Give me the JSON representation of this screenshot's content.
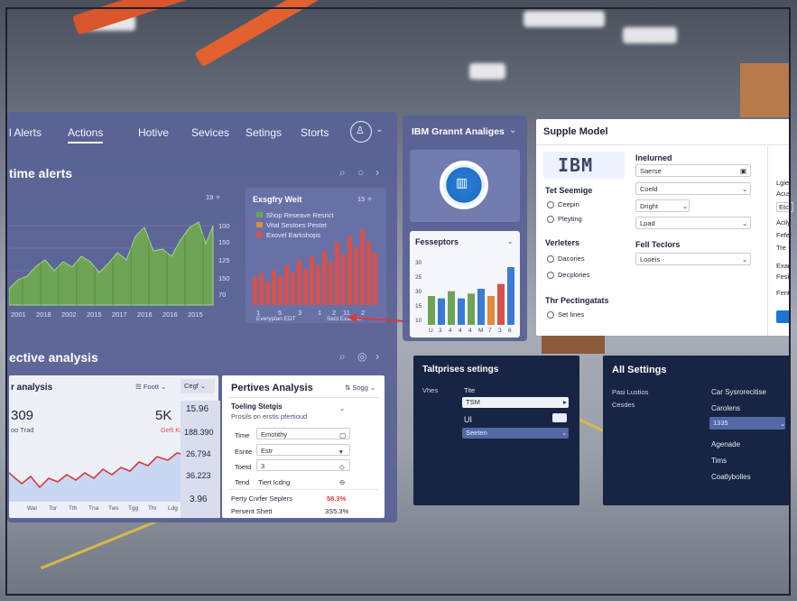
{
  "nav": {
    "items": [
      "l Alerts",
      "Actions",
      "Hotive",
      "Sevices",
      "Setings",
      "Storts"
    ]
  },
  "alerts": {
    "title": "time alerts",
    "chart1_badge": "19 ✧",
    "chart2_title": "Exsgfry Weit",
    "chart2_badge": "15 ✧",
    "chart2_legend": [
      "Shop Reseave Resrict",
      "Vital Sestoes Pestet",
      "Exovel Earkshops"
    ],
    "axis_ticks": [
      "100",
      "150",
      "125",
      "150",
      "70"
    ],
    "x_labels1": [
      "2001",
      "2018",
      "2002",
      "2015",
      "2017",
      "2016",
      "2016",
      "2015"
    ],
    "x_labels2": [
      "1",
      "5",
      "3",
      "1",
      "2",
      "11",
      "2"
    ],
    "chart2_foot_left": "Everyplan EDT",
    "chart2_foot_right": "Sect Exal Ser"
  },
  "predictive": {
    "title": "ective analysis",
    "sub_title": "r analysis",
    "filter_label": "Foott",
    "dropdown": "Cegf",
    "big_left": "309",
    "big_left_sub": "oo Trad",
    "big_right": "5K",
    "big_right_sub": "Geft Kigt",
    "x_labels": [
      "Wal",
      "Tor",
      "Tth",
      "Tna",
      "Tws",
      "Tgg",
      "Thr",
      "Ldg"
    ],
    "side_values": [
      "15.96",
      "188.390",
      "26.794",
      "36.223",
      "3.96"
    ]
  },
  "perives": {
    "title": "Pertives Analysis",
    "dropdown": "Sogg",
    "setting_title": "Toeling Stetgis",
    "setting_sub": "Prosils on erstis pfertioud",
    "rows": [
      {
        "label": "Time",
        "value": "Emotithy"
      },
      {
        "label": "Esnte",
        "value": "Estr"
      },
      {
        "label": "Toetd",
        "value": "3"
      },
      {
        "label": "Tend",
        "value": "Tiert Icdng"
      }
    ],
    "footer": [
      {
        "label": "Perty Cnrfer Seplers",
        "value": "58.3%"
      },
      {
        "label": "Persent Shett",
        "value": "3S5.3%"
      }
    ]
  },
  "ibm_panel": {
    "title": "IBM Grannt Analiges",
    "chart_title": "Fesseptors",
    "axis_ticks": [
      "30",
      "25",
      "30",
      "15",
      "10"
    ],
    "x_labels": [
      "U",
      "3",
      "4",
      "4",
      "4",
      "M",
      "7",
      "3",
      "6"
    ],
    "chart_data": {
      "type": "bar",
      "categories": [
        "U",
        "3",
        "4",
        "4",
        "4",
        "M",
        "7",
        "3",
        "6"
      ],
      "values": [
        12,
        11,
        14,
        11,
        13,
        15,
        12,
        17,
        24
      ],
      "ylim": [
        0,
        30
      ]
    }
  },
  "supplier": {
    "title": "Supple Model",
    "logo_text": "IBM",
    "left_items": [
      "Tet Seemige",
      "Ceepin",
      "Pleyting"
    ],
    "left_items2": [
      "Verleters",
      "Dacories",
      "Decplories"
    ],
    "left_items3": [
      "Thr Pectingatats",
      "Set Iines"
    ],
    "right_title": "Inelurned",
    "right_sub": "Saerse",
    "fields": [
      "Coeld",
      "Dright",
      "Lpad"
    ],
    "factors_title": "Fell Teclors",
    "factors_field": "Looeis",
    "edge_labels": [
      "Lgie",
      "Acus",
      "Etcl",
      "Acily",
      "Fefei",
      "Tre",
      "Exar",
      "Fesi",
      "Fent"
    ]
  },
  "enterprise": {
    "title": "Taltprises setings",
    "col_label": "Vhes",
    "row_label": "Tite",
    "field1": "TSM",
    "ui_label": "UI",
    "field2": "Seeten"
  },
  "all_settings": {
    "title": "All Settings",
    "left_labels": [
      "Pasi Lustios",
      "Cesdes"
    ],
    "right_labels": [
      "Car Sysrorecitise",
      "Carolens"
    ],
    "select_value": "1335",
    "items": [
      "Agenade",
      "Tims",
      "Coatlybolles"
    ]
  },
  "colors": {
    "glass": "#5862a0",
    "navy": "#172443",
    "green": "#6fa356",
    "red": "#d8504c",
    "blue": "#3a7bd5",
    "accent": "#1b76d1"
  }
}
